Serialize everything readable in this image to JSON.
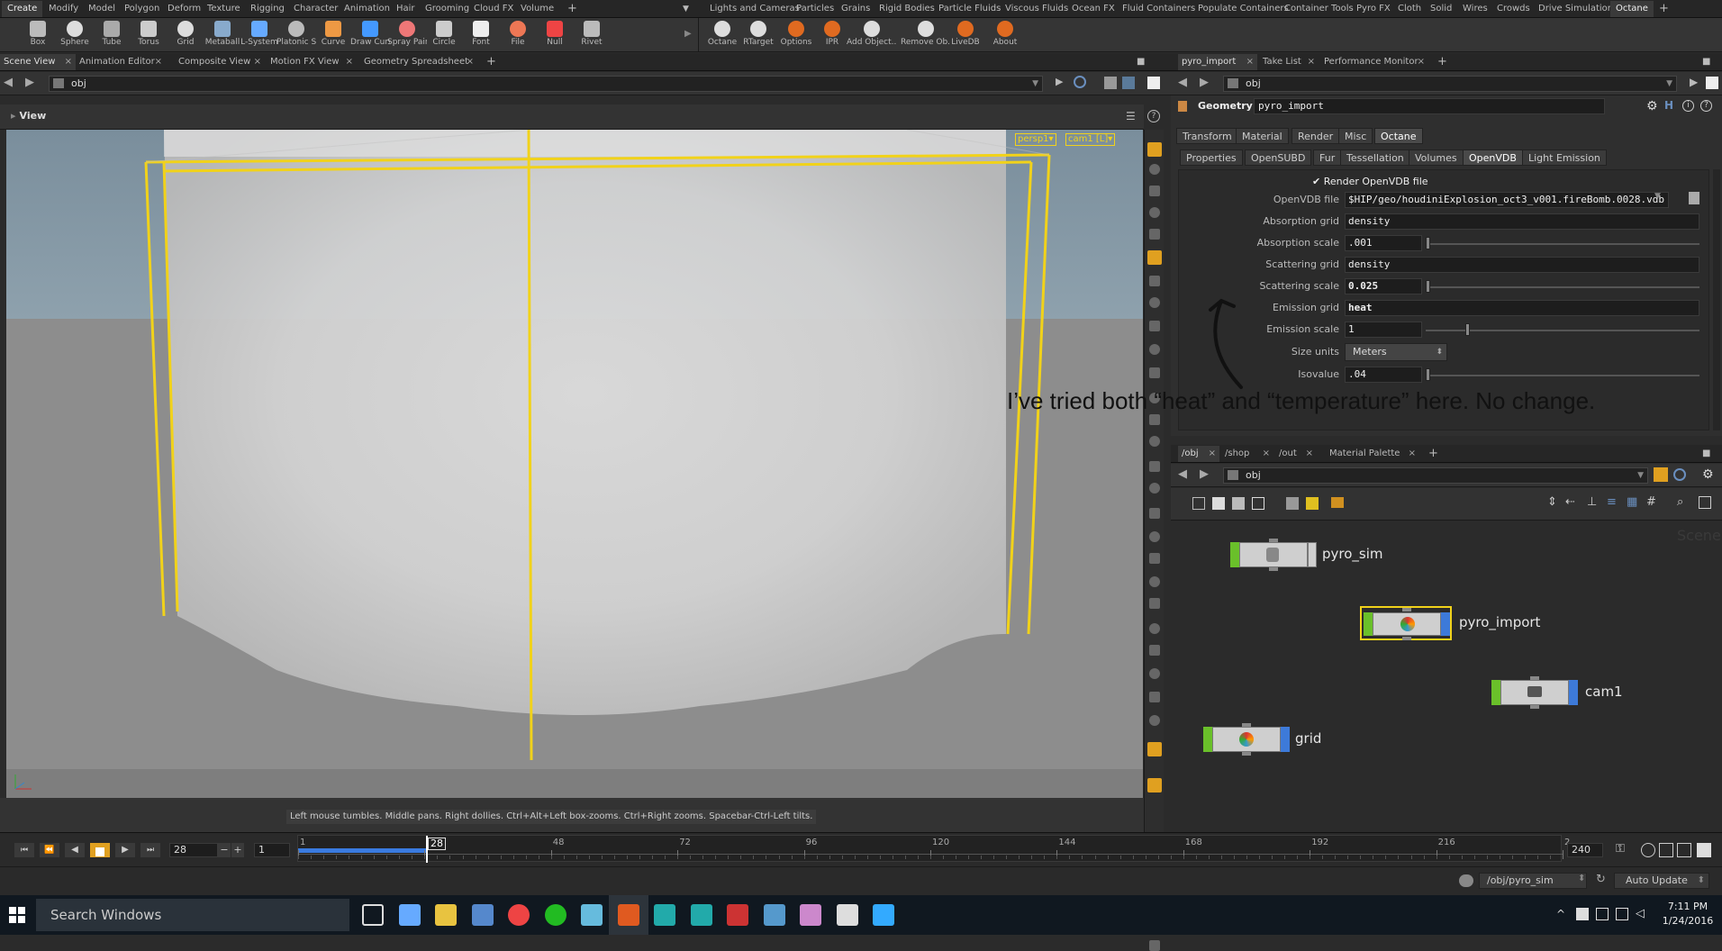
{
  "shelf_tabs_left": [
    "Create",
    "Modify",
    "Model",
    "Polygon",
    "Deform",
    "Texture",
    "Rigging",
    "Character",
    "Animation",
    "Hair",
    "Grooming",
    "Cloud FX",
    "Volume"
  ],
  "shelf_tabs_right": [
    "Lights and Cameras",
    "Particles",
    "Grains",
    "Rigid Bodies",
    "Particle Fluids",
    "Viscous Fluids",
    "Ocean FX",
    "Fluid Containers",
    "Populate Containers",
    "Container Tools",
    "Pyro FX",
    "Cloth",
    "Solid",
    "Wires",
    "Crowds",
    "Drive Simulation",
    "Octane"
  ],
  "shelf_tools_left": [
    "Box",
    "Sphere",
    "Tube",
    "Torus",
    "Grid",
    "Metaball",
    "L-System",
    "Platonic Sol...",
    "Curve",
    "Draw Curve",
    "Spray Paint",
    "Circle",
    "Font",
    "File",
    "Null",
    "Rivet"
  ],
  "shelf_tools_right": [
    "Octane",
    "RTarget",
    "Options",
    "IPR",
    "Add Object...",
    "Remove Ob...",
    "LiveDB",
    "About"
  ],
  "left_pane_tabs": [
    "Scene View",
    "Animation Editor",
    "Composite View",
    "Motion FX View",
    "Geometry Spreadsheet"
  ],
  "left_path": "obj",
  "viewport": {
    "title": "View",
    "persp_label": "persp1▾",
    "cam_label": "cam1 [L]▾",
    "hint": "Left mouse tumbles. Middle pans. Right dollies. Ctrl+Alt+Left box-zooms. Ctrl+Right zooms. Spacebar-Ctrl-Left tilts."
  },
  "param_pane": {
    "tabs": [
      "pyro_import",
      "Take List",
      "Performance Monitor"
    ],
    "path": "obj",
    "node_type": "Geometry",
    "node_name": "pyro_import",
    "main_tabs": [
      "Transform",
      "Material",
      "Render",
      "Misc",
      "Octane"
    ],
    "sub_tabs": [
      "Properties",
      "OpenSUBD",
      "Fur",
      "Tessellation",
      "Volumes",
      "OpenVDB",
      "Light Emission"
    ],
    "render_toggle": "Render OpenVDB file",
    "params": [
      {
        "label": "OpenVDB file",
        "value": "$HIP/geo/houdiniExplosion_oct3_v001.fireBomb.0028.vdb"
      },
      {
        "label": "Absorption grid",
        "value": "density"
      },
      {
        "label": "Absorption scale",
        "value": ".001"
      },
      {
        "label": "Scattering grid",
        "value": "density"
      },
      {
        "label": "Scattering scale",
        "value": "0.025"
      },
      {
        "label": "Emission grid",
        "value": "heat"
      },
      {
        "label": "Emission scale",
        "value": "1"
      },
      {
        "label": "Size units",
        "value": "Meters"
      },
      {
        "label": "Isovalue",
        "value": ".04"
      }
    ],
    "annotation": "I’ve tried both “heat” and “temperature” here.  No change."
  },
  "network_pane": {
    "tabs": [
      "/obj",
      "/shop",
      "/out",
      "Material Palette"
    ],
    "path": "obj",
    "watermark": "Scene",
    "nodes": [
      {
        "name": "pyro_sim"
      },
      {
        "name": "pyro_import"
      },
      {
        "name": "cam1"
      },
      {
        "name": "grid"
      }
    ]
  },
  "timeline": {
    "current_frame": "28",
    "step": "1",
    "start": "1",
    "end": "240",
    "marker": "28",
    "ticks": [
      "1",
      "24",
      "48",
      "72",
      "96",
      "120",
      "144",
      "168",
      "192",
      "216",
      "2"
    ]
  },
  "status": {
    "node_path": "/obj/pyro_sim",
    "update_mode": "Auto Update"
  },
  "taskbar": {
    "search": "Search Windows",
    "time": "7:11 PM",
    "date": "1/24/2016"
  }
}
